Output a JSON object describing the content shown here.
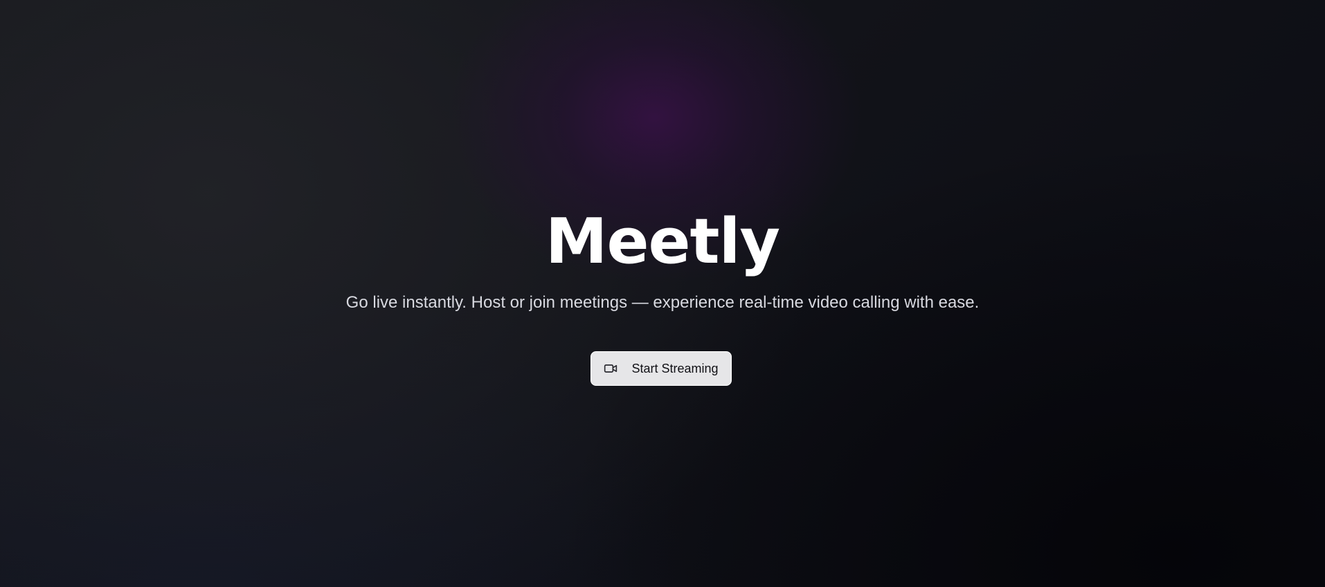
{
  "app": {
    "title": "Meetly",
    "tagline": "Go live instantly. Host or join meetings — experience real-time video calling with ease."
  },
  "cta": {
    "label": "Start Streaming",
    "icon": "video-camera-icon"
  },
  "colors": {
    "background": "#0e0f15",
    "accent_glow": "#2a1240",
    "title": "#ffffff",
    "subtitle": "#d8d9e0",
    "button_bg": "#e6e6e8",
    "button_text": "#111116"
  }
}
